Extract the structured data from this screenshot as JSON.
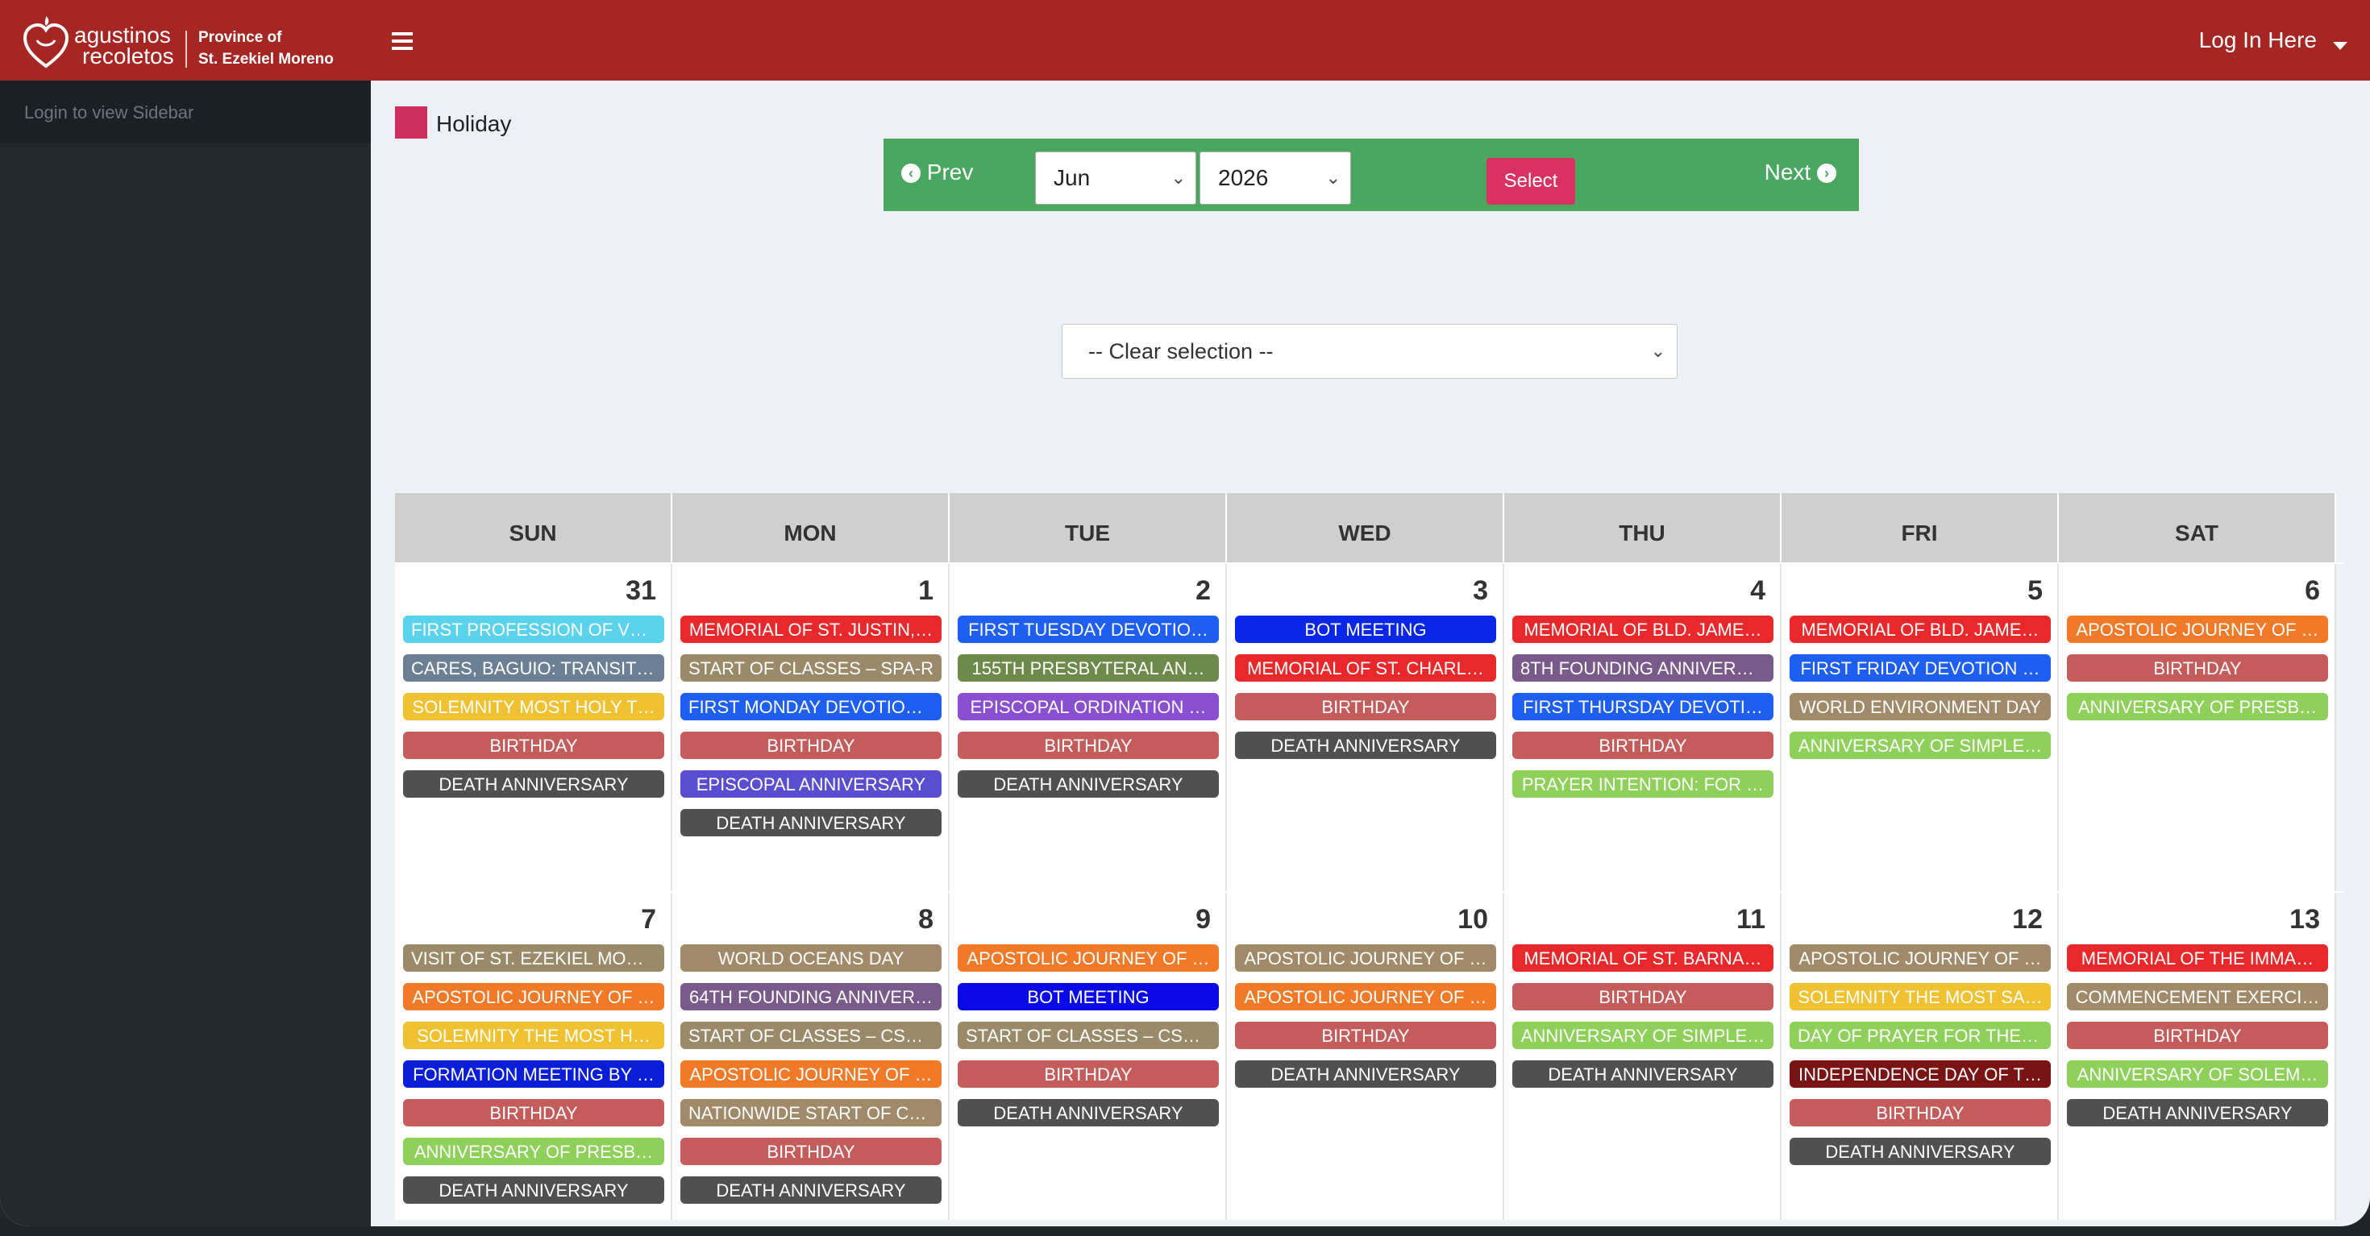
{
  "header": {
    "logo_line1": "agustinos",
    "logo_line2": "recoletos",
    "province_line1": "Province of",
    "province_line2": "St. Ezekiel Moreno",
    "login_label": "Log In Here"
  },
  "sidebar": {
    "notice": "Login to view Sidebar"
  },
  "legend": {
    "label": "Holiday",
    "color": "#cc2f5c"
  },
  "nav": {
    "prev_label": "Prev",
    "next_label": "Next",
    "month_value": "Jun",
    "year_value": "2026",
    "select_label": "Select"
  },
  "filter": {
    "value": "-- Clear selection --"
  },
  "calendar": {
    "weekdays": [
      "SUN",
      "MON",
      "TUE",
      "WED",
      "THU",
      "FRI",
      "SAT"
    ],
    "weeks": [
      [
        {
          "day": "31",
          "events": [
            {
              "label": "First Profession of Vo…",
              "color": "#5bd2ec"
            },
            {
              "label": "Cares, Baguio: Transiti…",
              "color": "#6b8094"
            },
            {
              "label": "Solemnity Most Holy T…",
              "color": "#f0c231"
            },
            {
              "label": "Birthday",
              "color": "#c45c5c"
            },
            {
              "label": "Death Anniversary",
              "color": "#505050"
            }
          ]
        },
        {
          "day": "1",
          "events": [
            {
              "label": "Memorial of St. Justin,…",
              "color": "#e8282b"
            },
            {
              "label": "Start of Classes – SPA-R",
              "color": "#9a8a6a"
            },
            {
              "label": "First Monday Devotion…",
              "color": "#1e5ef0"
            },
            {
              "label": "Birthday",
              "color": "#c45c5c"
            },
            {
              "label": "Episcopal Anniversary",
              "color": "#5a4ed0"
            },
            {
              "label": "Death Anniversary",
              "color": "#505050"
            }
          ]
        },
        {
          "day": "2",
          "events": [
            {
              "label": "First Tuesday Devotio…",
              "color": "#1e5ef0"
            },
            {
              "label": "155th Presbyteral An…",
              "color": "#6d8a4a"
            },
            {
              "label": "Episcopal Ordination …",
              "color": "#8a4ed0"
            },
            {
              "label": "Birthday",
              "color": "#c45c5c"
            },
            {
              "label": "Death Anniversary",
              "color": "#505050"
            }
          ]
        },
        {
          "day": "3",
          "events": [
            {
              "label": "BOT Meeting",
              "color": "#0a26e6"
            },
            {
              "label": "Memorial of St. Charl…",
              "color": "#e8282b"
            },
            {
              "label": "Birthday",
              "color": "#c45c5c"
            },
            {
              "label": "Death Anniversary",
              "color": "#505050"
            }
          ]
        },
        {
          "day": "4",
          "events": [
            {
              "label": "Memorial of Bld. Jame…",
              "color": "#e8282b"
            },
            {
              "label": "8th Founding Annivers…",
              "color": "#7a5a8a"
            },
            {
              "label": "First Thursday Devoti…",
              "color": "#1e5ef0"
            },
            {
              "label": "Birthday",
              "color": "#c45c5c"
            },
            {
              "label": "Prayer Intention: For …",
              "color": "#8fd05a"
            }
          ]
        },
        {
          "day": "5",
          "events": [
            {
              "label": "Memorial of Bld. Jame…",
              "color": "#e8282b"
            },
            {
              "label": "First Friday Devotion …",
              "color": "#1e5ef0"
            },
            {
              "label": "World Environment Day",
              "color": "#a08a6a"
            },
            {
              "label": "Anniversary of Simple…",
              "color": "#8fd05a"
            }
          ]
        },
        {
          "day": "6",
          "events": [
            {
              "label": "Apostolic Journey of …",
              "color": "#f07a28"
            },
            {
              "label": "Birthday",
              "color": "#c45c5c"
            },
            {
              "label": "Anniversary of Presb…",
              "color": "#8fd05a"
            }
          ]
        }
      ],
      [
        {
          "day": "7",
          "events": [
            {
              "label": "Visit of St. Ezekiel Mor…",
              "color": "#9a8a6a"
            },
            {
              "label": "Apostolic Journey of …",
              "color": "#f07a28"
            },
            {
              "label": "Solemnity The Most H…",
              "color": "#f0c231"
            },
            {
              "label": "Formation Meeting by …",
              "color": "#0a1ed8"
            },
            {
              "label": "Birthday",
              "color": "#c45c5c"
            },
            {
              "label": "Anniversary of Presb…",
              "color": "#8fd05a"
            },
            {
              "label": "Death Anniversary",
              "color": "#505050"
            }
          ]
        },
        {
          "day": "8",
          "events": [
            {
              "label": "World Oceans Day",
              "color": "#a08a6a"
            },
            {
              "label": "64th Founding Anniver…",
              "color": "#7a5a8a"
            },
            {
              "label": "Start of Classes – CSP-R",
              "color": "#9a8a6a"
            },
            {
              "label": "Apostolic Journey of …",
              "color": "#f07a28"
            },
            {
              "label": "Nationwide Start of Cl…",
              "color": "#a08a6a"
            },
            {
              "label": "Birthday",
              "color": "#c45c5c"
            },
            {
              "label": "Death Anniversary",
              "color": "#505050"
            }
          ]
        },
        {
          "day": "9",
          "events": [
            {
              "label": "Apostolic Journey of …",
              "color": "#f07a28"
            },
            {
              "label": "BOT Meeting",
              "color": "#0a0ae6"
            },
            {
              "label": "Start of Classes – CSN…",
              "color": "#9a8a6a"
            },
            {
              "label": "Birthday",
              "color": "#c45c5c"
            },
            {
              "label": "Death Anniversary",
              "color": "#505050"
            }
          ]
        },
        {
          "day": "10",
          "events": [
            {
              "label": "Apostolic Journey of …",
              "color": "#a08a6a"
            },
            {
              "label": "Apostolic Journey of …",
              "color": "#f07a28"
            },
            {
              "label": "Birthday",
              "color": "#c45c5c"
            },
            {
              "label": "Death Anniversary",
              "color": "#505050"
            }
          ]
        },
        {
          "day": "11",
          "events": [
            {
              "label": "Memorial of St. Barna…",
              "color": "#e8282b"
            },
            {
              "label": "Birthday",
              "color": "#c45c5c"
            },
            {
              "label": "Anniversary of Simple…",
              "color": "#8fd05a"
            },
            {
              "label": "Death Anniversary",
              "color": "#505050"
            }
          ]
        },
        {
          "day": "12",
          "events": [
            {
              "label": "Apostolic Journey of …",
              "color": "#a08a6a"
            },
            {
              "label": "Solemnity The Most Sa…",
              "color": "#f0c231"
            },
            {
              "label": "Day of Prayer for the …",
              "color": "#8fd05a"
            },
            {
              "label": "Independence Day of t…",
              "color": "#7a1414"
            },
            {
              "label": "Birthday",
              "color": "#c45c5c"
            },
            {
              "label": "Death Anniversary",
              "color": "#505050"
            }
          ]
        },
        {
          "day": "13",
          "events": [
            {
              "label": "Memorial of the Imma…",
              "color": "#e8282b"
            },
            {
              "label": "Commencement Exerci…",
              "color": "#a08a6a"
            },
            {
              "label": "Birthday",
              "color": "#c45c5c"
            },
            {
              "label": "Anniversary of Solem…",
              "color": "#8fd05a"
            },
            {
              "label": "Death Anniversary",
              "color": "#505050"
            }
          ]
        }
      ]
    ]
  }
}
